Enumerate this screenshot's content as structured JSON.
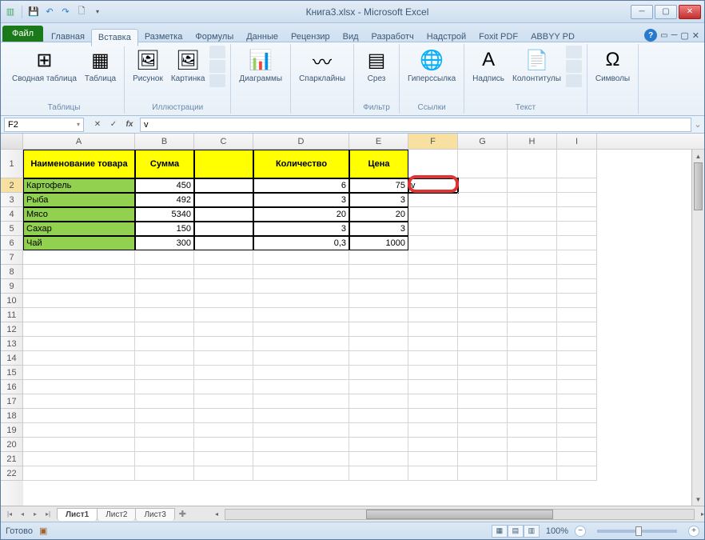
{
  "title": "Книга3.xlsx - Microsoft Excel",
  "file_tab": "Файл",
  "tabs": [
    "Главная",
    "Вставка",
    "Разметка",
    "Формулы",
    "Данные",
    "Рецензир",
    "Вид",
    "Разработч",
    "Надстрой",
    "Foxit PDF",
    "ABBYY PD"
  ],
  "active_tab_index": 1,
  "ribbon": {
    "groups": [
      {
        "name": "Таблицы",
        "buttons": [
          {
            "label": "Сводная\nтаблица",
            "icon": "⊞"
          },
          {
            "label": "Таблица",
            "icon": "▦"
          }
        ]
      },
      {
        "name": "Иллюстрации",
        "buttons": [
          {
            "label": "Рисунок",
            "icon": "🖼"
          },
          {
            "label": "Картинка",
            "icon": "🖼"
          }
        ],
        "mini": true
      },
      {
        "name": "",
        "buttons": [
          {
            "label": "Диаграммы",
            "icon": "📊"
          }
        ]
      },
      {
        "name": "",
        "buttons": [
          {
            "label": "Спарклайны",
            "icon": "〰"
          }
        ]
      },
      {
        "name": "Фильтр",
        "buttons": [
          {
            "label": "Срез",
            "icon": "▤"
          }
        ]
      },
      {
        "name": "Ссылки",
        "buttons": [
          {
            "label": "Гиперссылка",
            "icon": "🌐"
          }
        ]
      },
      {
        "name": "Текст",
        "buttons": [
          {
            "label": "Надпись",
            "icon": "A"
          },
          {
            "label": "Колонтитулы",
            "icon": "📄"
          }
        ],
        "mini": true
      },
      {
        "name": "",
        "buttons": [
          {
            "label": "Символы",
            "icon": "Ω"
          }
        ]
      }
    ]
  },
  "namebox": "F2",
  "formula": "v",
  "columns": [
    "A",
    "B",
    "C",
    "D",
    "E",
    "F",
    "G",
    "H",
    "I"
  ],
  "header_row": {
    "A": "Наименование товара",
    "B": "Сумма",
    "C": "",
    "D": "Количество",
    "E": "Цена"
  },
  "data_rows": [
    {
      "r": 2,
      "name": "Картофель",
      "sum": "450",
      "qty": "6",
      "price": "75",
      "f": "v"
    },
    {
      "r": 3,
      "name": "Рыба",
      "sum": "492",
      "qty": "3",
      "price": "3"
    },
    {
      "r": 4,
      "name": "Мясо",
      "sum": "5340",
      "qty": "20",
      "price": "20"
    },
    {
      "r": 5,
      "name": "Сахар",
      "sum": "150",
      "qty": "3",
      "price": "3"
    },
    {
      "r": 6,
      "name": "Чай",
      "sum": "300",
      "qty": "0,3",
      "price": "1000"
    }
  ],
  "empty_rows": [
    7,
    8,
    9,
    10,
    11,
    12,
    13,
    14,
    15,
    16,
    17,
    18,
    19,
    20,
    21,
    22
  ],
  "sheets": [
    "Лист1",
    "Лист2",
    "Лист3"
  ],
  "active_sheet": 0,
  "status": "Готово",
  "zoom": "100%",
  "selected_col": "F",
  "selected_row": 2
}
